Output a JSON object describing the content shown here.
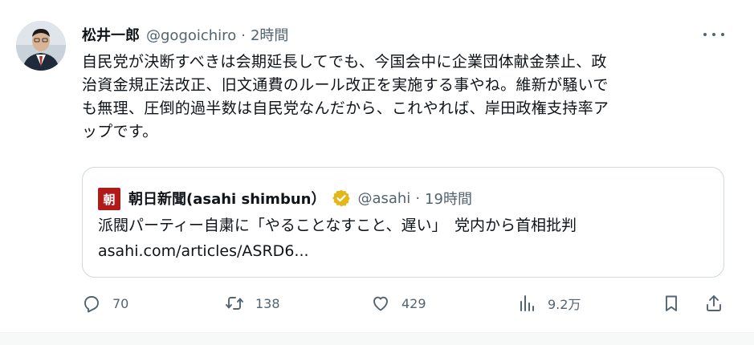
{
  "author": {
    "name": "松井一郎",
    "handle": "@gogoichiro",
    "separator": "·",
    "time": "2時間"
  },
  "tweet_text": "自民党が決断すべきは会期延長してでも、今国会中に企業団体献金禁止、政\n治資金規正法改正、旧文通費のルール改正を実施する事やね。維新が騒いで\nも無理、圧倒的過半数は自民党なんだから、これやれば、岸田政権支持率ア\nップです。",
  "quoted": {
    "logo_text": "朝",
    "name": "朝日新聞(asahi shimbun）",
    "handle": "@asahi",
    "separator": "·",
    "time": "19時間",
    "text": "派閥パーティー自粛に「やることなすこと、遅い」　党内から首相批判",
    "link": "asahi.com/articles/ASRD6...",
    "logo_color": "#b01a1a",
    "verified_color": "#e2b719"
  },
  "actions": {
    "reply": {
      "icon": "reply-icon",
      "count": "70"
    },
    "retweet": {
      "icon": "retweet-icon",
      "count": "138"
    },
    "like": {
      "icon": "heart-icon",
      "count": "429"
    },
    "views": {
      "icon": "views-icon",
      "count": "9.2万"
    },
    "bookmark": {
      "icon": "bookmark-icon"
    },
    "share": {
      "icon": "share-icon"
    }
  },
  "colors": {
    "text": "#0f1419",
    "secondary": "#536471",
    "border": "#cfd9de"
  }
}
